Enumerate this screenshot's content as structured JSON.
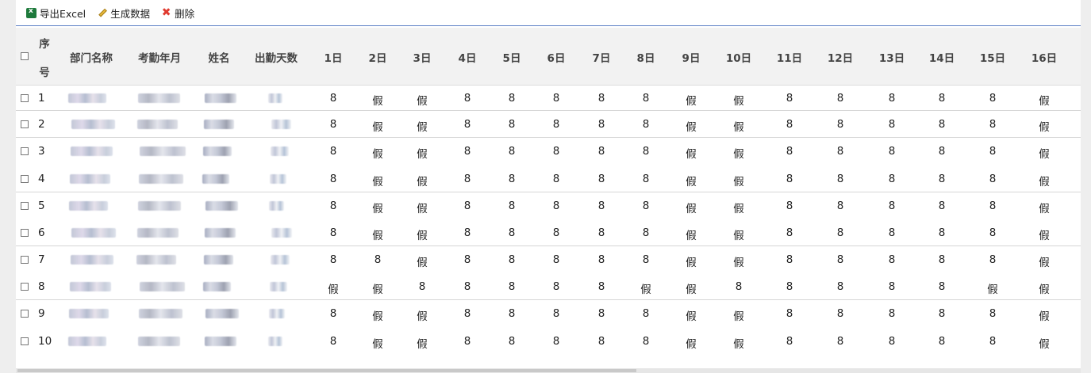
{
  "toolbar": {
    "export_label": "导出Excel",
    "generate_label": "生成数据",
    "delete_label": "删除"
  },
  "table": {
    "headers": {
      "seq_top": "序",
      "seq_bottom": "号",
      "dept": "部门名称",
      "month": "考勤年月",
      "name": "姓名",
      "days_present": "出勤天数",
      "days": [
        "1日",
        "2日",
        "3日",
        "4日",
        "5日",
        "6日",
        "7日",
        "8日",
        "9日",
        "10日",
        "11日",
        "12日",
        "13日",
        "14日",
        "15日",
        "16日"
      ]
    },
    "rows": [
      {
        "no": "1",
        "days": [
          "8",
          "假",
          "假",
          "8",
          "8",
          "8",
          "8",
          "8",
          "假",
          "假",
          "8",
          "8",
          "8",
          "8",
          "8",
          "假"
        ]
      },
      {
        "no": "2",
        "days": [
          "8",
          "假",
          "假",
          "8",
          "8",
          "8",
          "8",
          "8",
          "假",
          "假",
          "8",
          "8",
          "8",
          "8",
          "8",
          "假"
        ]
      },
      {
        "no": "3",
        "days": [
          "8",
          "假",
          "假",
          "8",
          "8",
          "8",
          "8",
          "8",
          "假",
          "假",
          "8",
          "8",
          "8",
          "8",
          "8",
          "假"
        ]
      },
      {
        "no": "4",
        "days": [
          "8",
          "假",
          "假",
          "8",
          "8",
          "8",
          "8",
          "8",
          "假",
          "假",
          "8",
          "8",
          "8",
          "8",
          "8",
          "假"
        ]
      },
      {
        "no": "5",
        "days": [
          "8",
          "假",
          "假",
          "8",
          "8",
          "8",
          "8",
          "8",
          "假",
          "假",
          "8",
          "8",
          "8",
          "8",
          "8",
          "假"
        ]
      },
      {
        "no": "6",
        "days": [
          "8",
          "假",
          "假",
          "8",
          "8",
          "8",
          "8",
          "8",
          "假",
          "假",
          "8",
          "8",
          "8",
          "8",
          "8",
          "假"
        ]
      },
      {
        "no": "7",
        "days": [
          "8",
          "8",
          "假",
          "8",
          "8",
          "8",
          "8",
          "8",
          "假",
          "假",
          "8",
          "8",
          "8",
          "8",
          "8",
          "假"
        ]
      },
      {
        "no": "8",
        "days": [
          "假",
          "假",
          "8",
          "8",
          "8",
          "8",
          "8",
          "假",
          "假",
          "8",
          "8",
          "8",
          "8",
          "8",
          "假",
          "假"
        ]
      },
      {
        "no": "9",
        "days": [
          "8",
          "假",
          "假",
          "8",
          "8",
          "8",
          "8",
          "8",
          "假",
          "假",
          "8",
          "8",
          "8",
          "8",
          "8",
          "假"
        ]
      },
      {
        "no": "10",
        "days": [
          "8",
          "假",
          "假",
          "8",
          "8",
          "8",
          "8",
          "8",
          "假",
          "假",
          "8",
          "8",
          "8",
          "8",
          "8",
          "假"
        ]
      }
    ]
  }
}
